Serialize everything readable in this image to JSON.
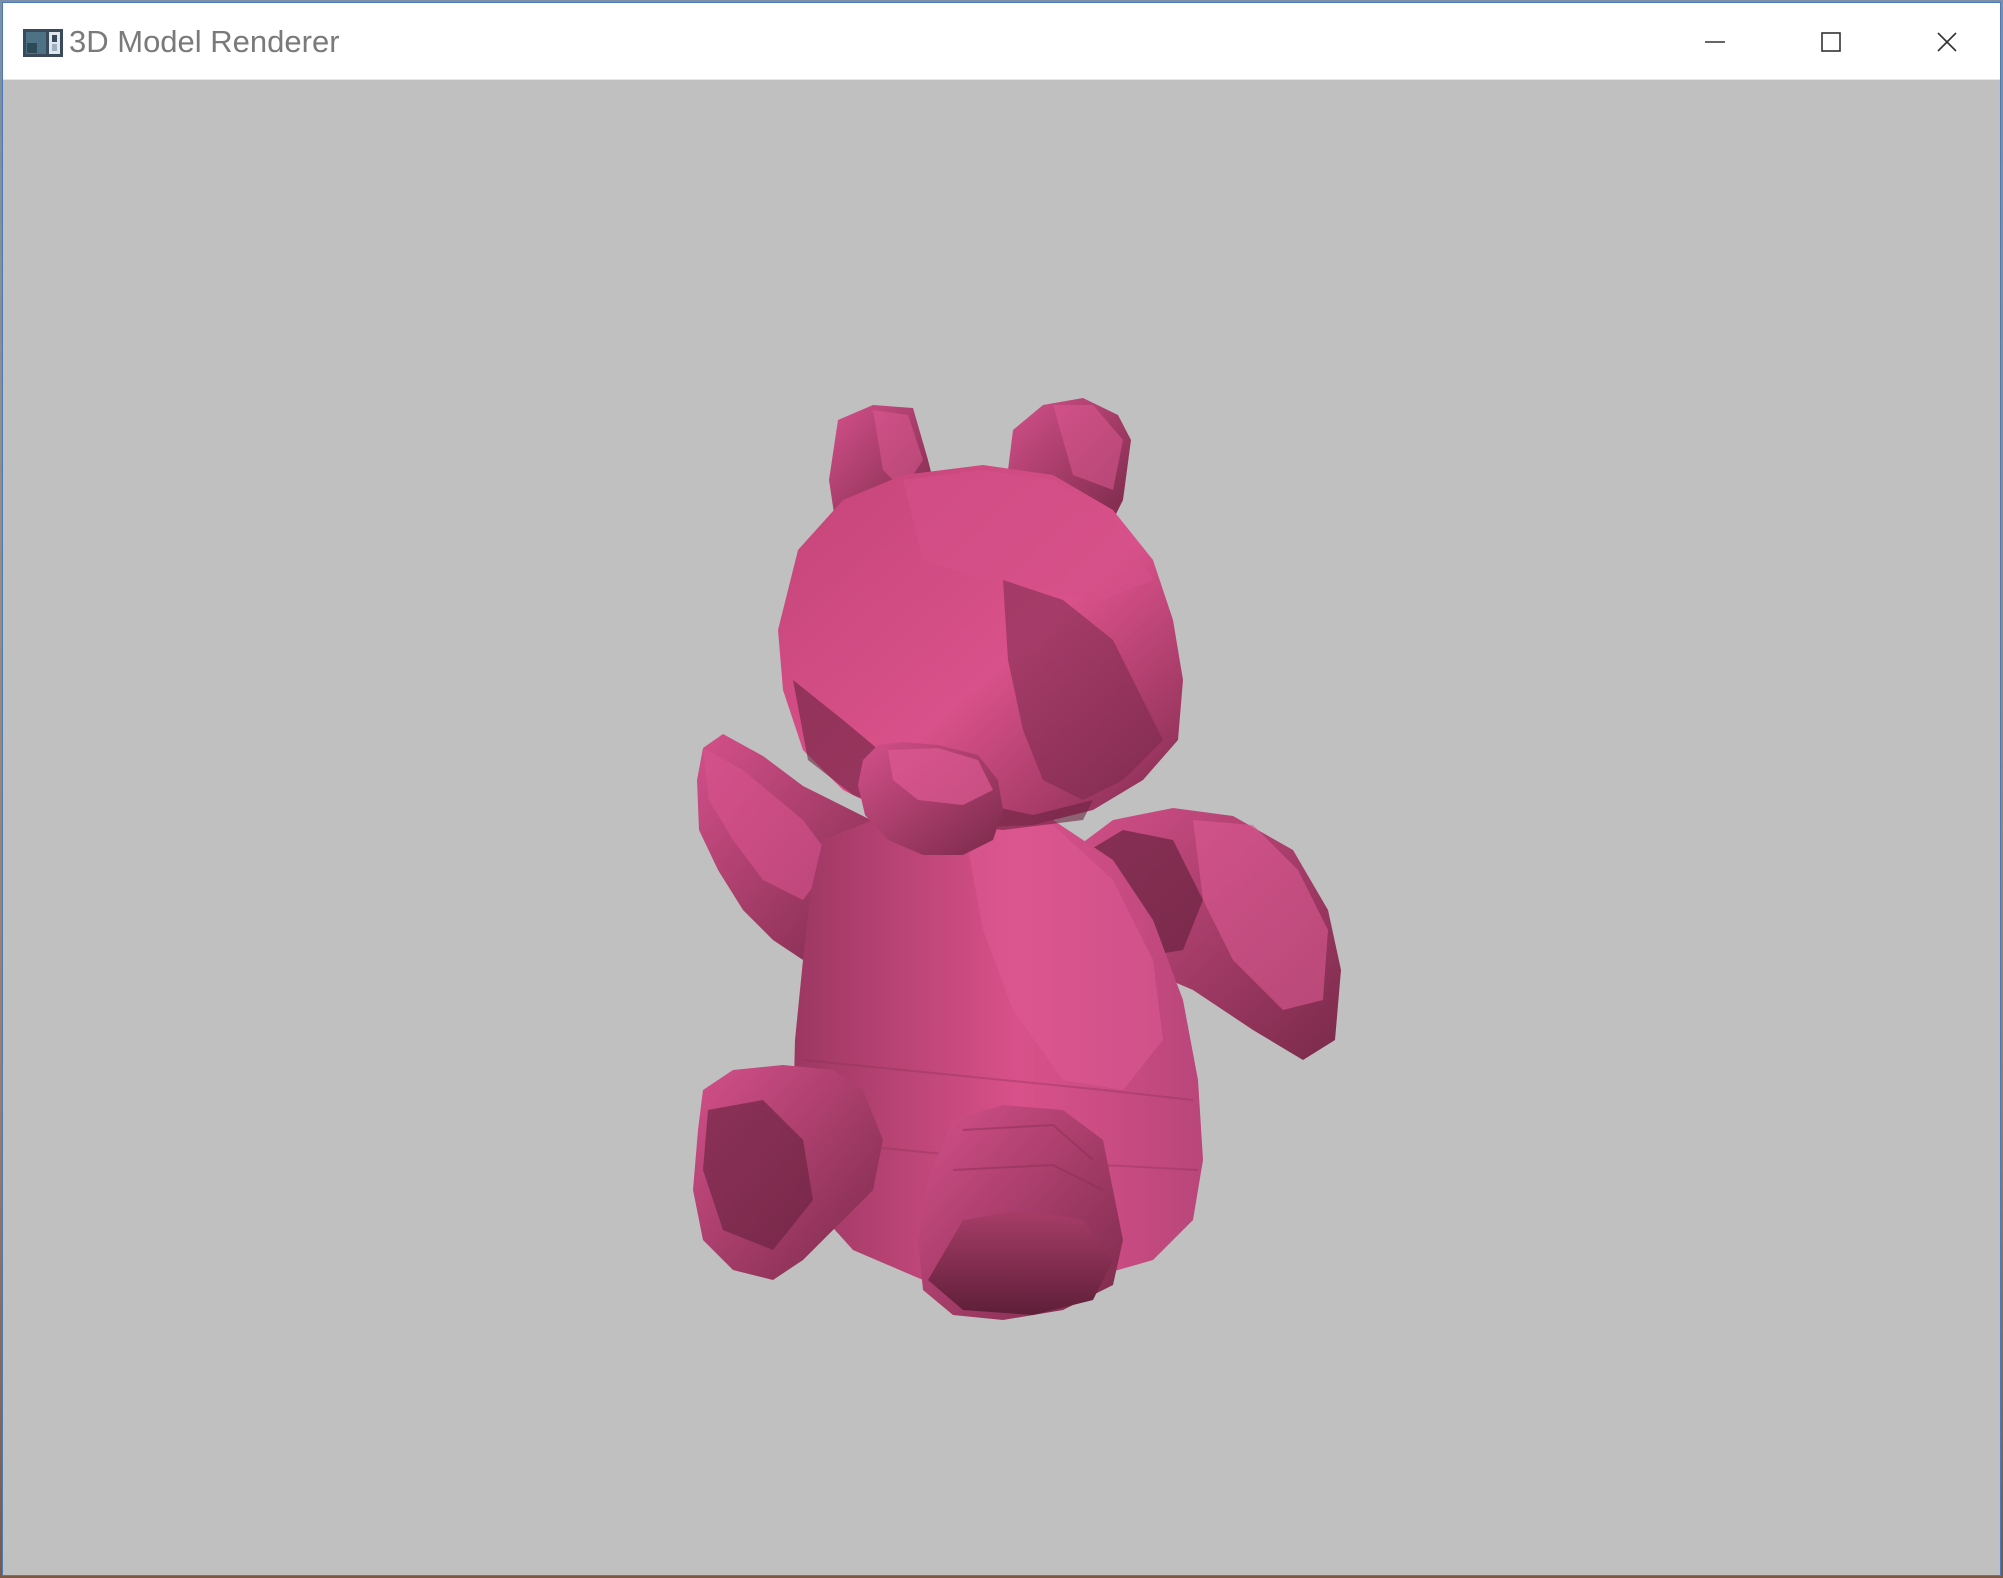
{
  "window": {
    "title": "3D Model Renderer",
    "icon": "app-icon",
    "controls": {
      "minimize_icon": "minimize-icon",
      "maximize_icon": "maximize-icon",
      "close_icon": "close-icon"
    }
  },
  "viewport": {
    "background_color": "#c0c0c0",
    "model": {
      "name": "teddy bear",
      "base_color": "#d94f8a"
    }
  }
}
